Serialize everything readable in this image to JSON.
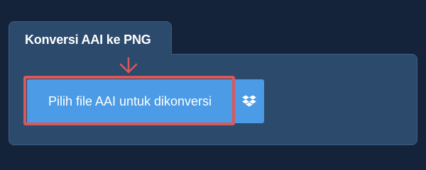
{
  "converter": {
    "tab_title": "Konversi AAI ke PNG",
    "choose_file_label": "Pilih file AAI untuk dikonversi",
    "dropbox_icon": "dropbox-icon",
    "arrow_icon": "arrow-down-icon"
  },
  "colors": {
    "background": "#14233a",
    "panel": "#2b4a6c",
    "button": "#4b9be6",
    "highlight": "#d9585b"
  }
}
